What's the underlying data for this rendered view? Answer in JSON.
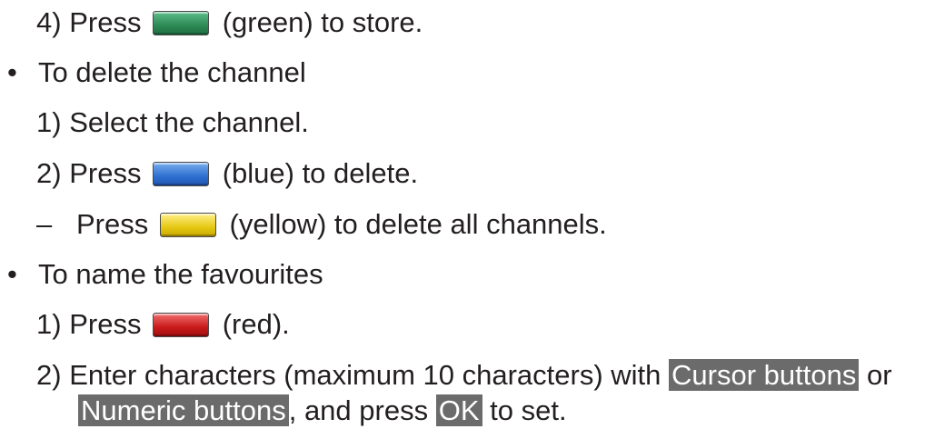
{
  "lines": {
    "step4": {
      "num": "4)",
      "before": "Press",
      "after": "(green) to store."
    },
    "bullet_delete": {
      "marker": "•",
      "text": "To delete the channel"
    },
    "delete_step1": {
      "num": "1)",
      "text": "Select the channel."
    },
    "delete_step2": {
      "num": "2)",
      "before": "Press",
      "after": "(blue) to delete."
    },
    "delete_all": {
      "marker": "–",
      "before": "Press",
      "after": "(yellow) to delete all channels."
    },
    "bullet_name": {
      "marker": "•",
      "text": "To name the favourites"
    },
    "name_step1": {
      "num": "1)",
      "before": "Press",
      "after": "(red)."
    },
    "name_step2": {
      "num": "2)",
      "text_a": "Enter characters (maximum 10 characters) with",
      "hl_cursor": "Cursor buttons",
      "text_b": "or",
      "hl_numeric": "Numeric buttons",
      "text_c": ", and press",
      "hl_ok": "OK",
      "text_d": "to set."
    }
  },
  "key_colors": {
    "green": "#2d8a55",
    "blue": "#2f6fd0",
    "yellow": "#e6c813",
    "red": "#c91a1a"
  },
  "highlight_color": "#6b6b6b"
}
